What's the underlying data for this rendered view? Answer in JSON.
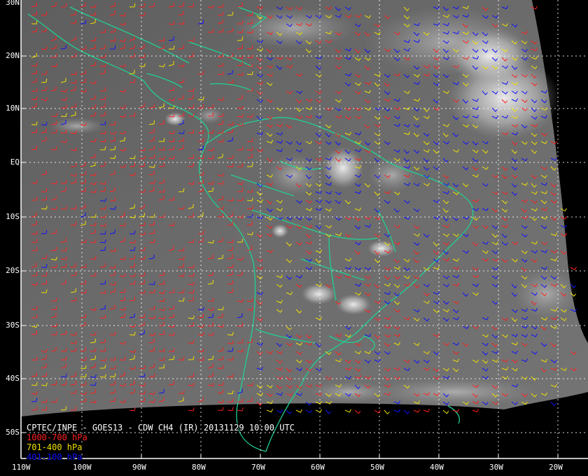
{
  "map": {
    "lat_labels": [
      "30N",
      "20N",
      "10N",
      "EQ",
      "10S",
      "20S",
      "30S",
      "40S",
      "50S"
    ],
    "lon_labels": [
      "110W",
      "100W",
      "90W",
      "80W",
      "70W",
      "60W",
      "50W",
      "40W",
      "30W",
      "20W"
    ]
  },
  "caption": {
    "title": "CPTEC/INPE - GOES13 - CDW CH4 (IR) 20131129 10:00 UTC",
    "legend": [
      {
        "label": "1000-700 hPa",
        "color": "#ff2020"
      },
      {
        "label": "701-400 hPa",
        "color": "#f0e000"
      },
      {
        "label": "401-100 hPa",
        "color": "#1010ff"
      }
    ]
  },
  "colors": {
    "coastline": "#20d090",
    "grid": "#ffffff",
    "border_frame": "#ffffff",
    "space": "#000000"
  }
}
